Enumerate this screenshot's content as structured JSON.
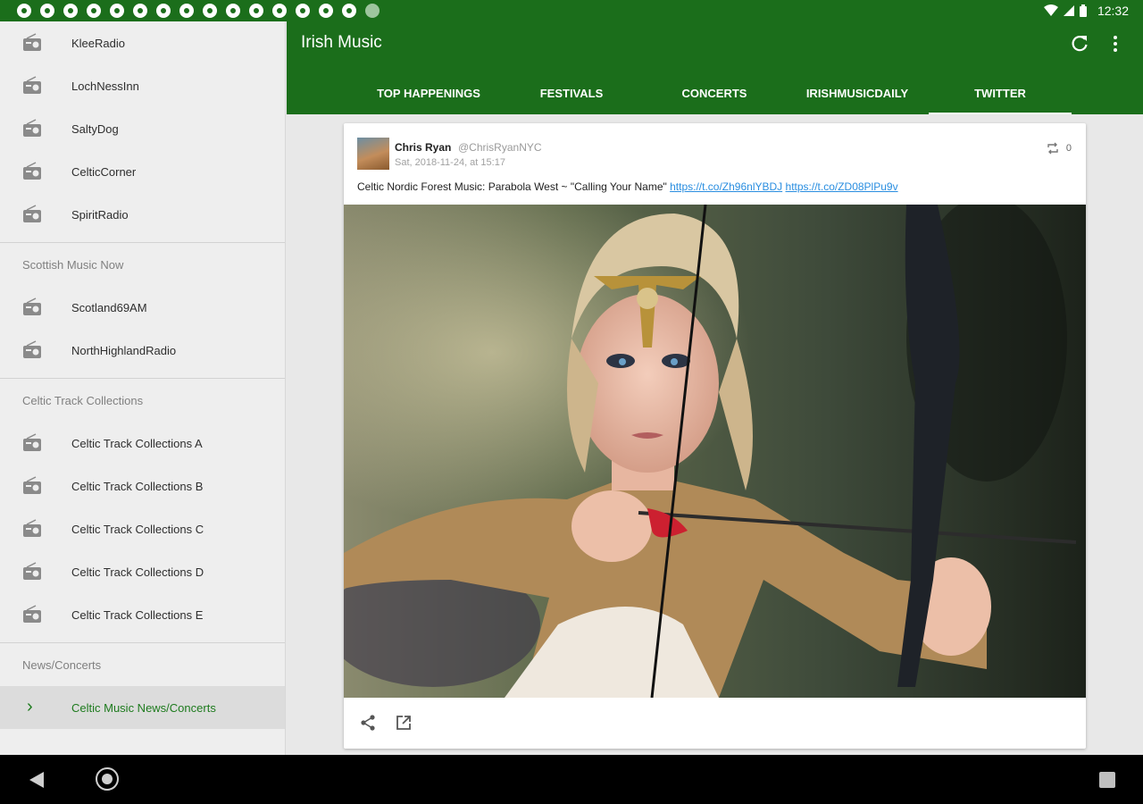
{
  "status_bar": {
    "time": "12:32",
    "notification_icons": [
      "notification-icon",
      "notification-icon",
      "notification-icon",
      "notification-icon",
      "notification-icon",
      "settings-icon",
      "bell-icon",
      "bell-icon",
      "notification-icon",
      "notification-icon",
      "notification-icon",
      "notification-icon",
      "notification-icon",
      "notification-icon",
      "sd-card-icon",
      "circle-icon"
    ]
  },
  "app_bar": {
    "title": "Irish Music",
    "tabs": [
      {
        "label": "TOP HAPPENINGS"
      },
      {
        "label": "FESTIVALS"
      },
      {
        "label": "CONCERTS"
      },
      {
        "label": "IRISHMUSICDAILY"
      },
      {
        "label": "TWITTER"
      }
    ],
    "active_tab": "TWITTER"
  },
  "sidebar": {
    "group1": [
      {
        "label": "KleeRadio"
      },
      {
        "label": "LochNessInn"
      },
      {
        "label": "SaltyDog"
      },
      {
        "label": "CelticCorner"
      },
      {
        "label": "SpiritRadio"
      }
    ],
    "section2_header": "Scottish Music Now",
    "group2": [
      {
        "label": "Scotland69AM"
      },
      {
        "label": "NorthHighlandRadio"
      }
    ],
    "section3_header": "Celtic Track Collections",
    "group3": [
      {
        "label": "Celtic Track Collections A"
      },
      {
        "label": "Celtic Track Collections B"
      },
      {
        "label": "Celtic Track Collections C"
      },
      {
        "label": "Celtic Track Collections D"
      },
      {
        "label": "Celtic Track Collections E"
      }
    ],
    "section4_header": "News/Concerts",
    "group4": [
      {
        "label": "Celtic Music News/Concerts"
      }
    ]
  },
  "tweet": {
    "author_name": "Chris Ryan",
    "author_handle": "@ChrisRyanNYC",
    "date": "Sat, 2018-11-24, at 15:17",
    "retweet_count": "0",
    "text": "Celtic Nordic Forest Music: Parabola West ~ \"Calling Your Name\" ",
    "link1": "https://t.co/Zh96nlYBDJ",
    "link2": "https://t.co/ZD08PlPu9v"
  },
  "colors": {
    "primary": "#1b6e1b",
    "accent_active": "#1e7b1e",
    "link": "#2a8ee0"
  }
}
